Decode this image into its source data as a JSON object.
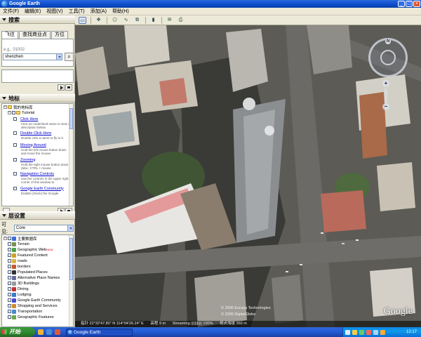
{
  "window": {
    "title": "Google Earth",
    "minimize": "_",
    "maximize": "□",
    "close": "×"
  },
  "menu": [
    "文件(F)",
    "编辑(E)",
    "视图(V)",
    "工具(T)",
    "添加(A)",
    "帮助(H)"
  ],
  "search_panel": {
    "title": "搜索",
    "tabs": [
      "飞往",
      "查找商业点",
      "方位"
    ],
    "hint": "e.g., 01002",
    "value": "shenzhen",
    "search_icon": "⌕"
  },
  "places_panel": {
    "title": "地标",
    "items": [
      {
        "label": "我的地标库",
        "type": "folder"
      },
      {
        "label": "Tutorial",
        "type": "folder"
      },
      {
        "label": "Click Here",
        "desc": "Click an underlined name to view a description below."
      },
      {
        "label": "Double Click Here",
        "desc": "Double click a name to fly to it."
      },
      {
        "label": "Moving Around",
        "desc": "Hold the left mouse button down and move the mouse."
      },
      {
        "label": "Zooming",
        "desc": "Hold the right mouse button down (Mac: CTRL + mouse"
      },
      {
        "label": "Navigation Controls",
        "desc": "Use the controls in the upper right corner of this window to"
      },
      {
        "label": "Google Earth Community",
        "desc": "Enable (check) the Google"
      }
    ]
  },
  "layers_panel": {
    "title": "层设置",
    "view_label": "可见:",
    "view_value": "Core",
    "items": [
      {
        "label": "主要数据库",
        "color": "#3b6fd4"
      },
      {
        "label": "Terrain",
        "color": "#7a8f55"
      },
      {
        "label": "Geographic Web",
        "color": "#4aa54a",
        "badge": "NEW"
      },
      {
        "label": "Featured Content",
        "color": "#c9a227"
      },
      {
        "label": "roads",
        "color": "#d9b443"
      },
      {
        "label": "borders",
        "color": "#c45a2c"
      },
      {
        "label": "Populated Places",
        "color": "#333333"
      },
      {
        "label": "Alternative Place Names",
        "color": "#6a6a9a"
      },
      {
        "label": "3D Buildings",
        "color": "#9a9a9a"
      },
      {
        "label": "Dining",
        "color": "#c83030"
      },
      {
        "label": "Lodging",
        "color": "#3a7ac8"
      },
      {
        "label": "Google Earth Community",
        "color": "#4a4ad0"
      },
      {
        "label": "Shopping and Services",
        "color": "#d08a30"
      },
      {
        "label": "Transportation",
        "color": "#4a8acd"
      },
      {
        "label": "Geographic Features",
        "color": "#6aa84f"
      }
    ]
  },
  "map": {
    "copyright1": "© 2006 Europa Technologies",
    "copyright2": "© 2006 DigitalGlobe",
    "status": {
      "pointer": "指针 22°32'47.80\" N   114°04'26.24\" E",
      "elev": "高程      9 m",
      "streaming": "Streaming ||||||||||| 100%",
      "eye": "视点海拔     360 m"
    },
    "logo": "Google",
    "compass_n": "N",
    "zoom_in": "+",
    "zoom_out": "−"
  },
  "taskbar": {
    "start": "开始",
    "task": "Google Earth",
    "clock": "12:17"
  }
}
